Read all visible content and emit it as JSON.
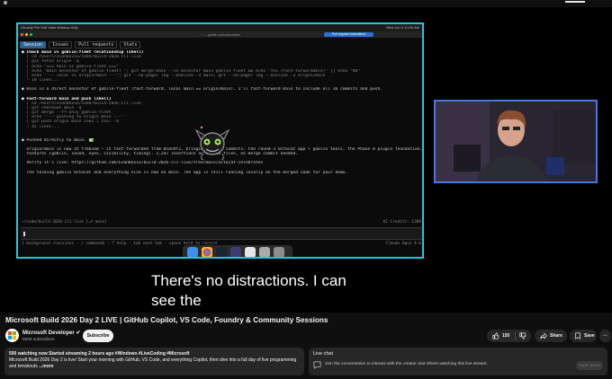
{
  "terminal": {
    "tabs": [
      "Session",
      "Issues",
      "Pull requests",
      "Stats"
    ],
    "lines": [
      {
        "text": "● Check main vs goblin-fleet relationship (shell)",
        "cls": "b"
      },
      {
        "text": "  │ cd /Users/evanbovie/code/build-2026-cli-live",
        "cls": "dim"
      },
      {
        "text": "  │ git fetch origin -q",
        "cls": "dim"
      },
      {
        "text": "  │ echo \"=== main vs goblin-fleet ===\"",
        "cls": "dim"
      },
      {
        "text": "  │ echo \"main ancestor of goblin-fleet? \"; git merge-base --is-ancestor main goblin-fleet && echo \"YES (fast-forwardable)\" || echo \"NO\"",
        "cls": "dim"
      },
      {
        "text": "  │ echo \"--- local vs origin/main ---\"; git --no-pager log --oneline -3 main; git --no-pager log --oneline -3 origin/main",
        "cls": "dim"
      },
      {
        "text": "  └ 10 lines...",
        "cls": "dim"
      },
      {
        "text": "",
        "cls": "sp"
      },
      {
        "text": "● main is a direct ancestor of goblin-fleet (fast-forward, local main == origin/main). I'll fast-forward main to include all 16 commits and push.",
        "cls": ""
      },
      {
        "text": "",
        "cls": "sp"
      },
      {
        "text": "● Fast-forward main and push (shell)",
        "cls": "b"
      },
      {
        "text": "  │ cd /Users/evanbovie/code/build-2026-cli-live",
        "cls": "dim"
      },
      {
        "text": "  │ git checkout main -q",
        "cls": "dim"
      },
      {
        "text": "  │ git merge --ff-only goblin-fleet",
        "cls": "dim"
      },
      {
        "text": "  │ echo \"--- pushing to origin main ---\"",
        "cls": "dim"
      },
      {
        "text": "  │ git push origin main 2>&1 | tail -8",
        "cls": "dim"
      },
      {
        "text": "  └ 45 lines...",
        "cls": "dim"
      },
      {
        "text": "",
        "cls": "sp"
      },
      {
        "text": "",
        "cls": "sp"
      },
      {
        "text": "● Pushed directly to main. ✅",
        "cls": ""
      },
      {
        "text": "",
        "cls": "sp"
      },
      {
        "text": "  origin/main is now at f7bb1e0 — it fast-forwarded from 85a59f2, bringing all 16 commits: the round-3 Octocat app + goblin tools, the Phase 0 plugin foundation, and all 5 fleet",
        "cls": ""
      },
      {
        "text": "  features (goblin, sound, eyes, visibility, timing). 2,247 insertions across 18 files, no merge commit needed.",
        "cls": ""
      },
      {
        "text": "",
        "cls": "sp"
      },
      {
        "text": "  Verify it's live: https://github.com/EvanBovie/build-2026-cli-live/tree/main/octocat-celebrates",
        "cls": ""
      },
      {
        "text": "",
        "cls": "sp"
      },
      {
        "text": "  The talking goblin Octocat and everything else is now on main. The app is still running locally on the merged code for your demo.",
        "cls": ""
      }
    ],
    "path": "~/code/build-2026-cli-live [⎇ main]",
    "credits": "AI Credits: 1309",
    "hints": "1 background /sessions · / commands · ? help · tab next tab · space hold to record",
    "model": "Claude Opus 4.6"
  },
  "menubar": {
    "left": "Ghostty   File   Edit   View   Window   Help",
    "right": "Wed Jun 3  10:00 AM"
  },
  "window_title": "~ — goblin-octocat-client",
  "window_badge": "Pull request instructions",
  "caption": "There's no distractions. I can see the",
  "video": {
    "title": "Microsoft Build 2026 Day 2 LIVE | GitHub Copilot, VS Code, Foundry & Community Sessions"
  },
  "channel": {
    "name": "Microsoft Developer",
    "subscribers": "883K subscribers",
    "subscribe_label": "Subscribe"
  },
  "actions": {
    "likes": "155",
    "share": "Share",
    "save": "Save"
  },
  "description": {
    "meta": "500 watching now  Started streaming 2 hours ago  #Windows #LiveCoding #Microsoft",
    "text": "Microsoft Build 2026 Day 2 is live! Start your morning with GitHub, VS Code, and everything Copilot, then dive into a full day of live programming and breakouts",
    "more": "...more"
  },
  "chat": {
    "header": "Live chat",
    "text": "Join the conversation to interact with the creator and others watching this live stream.",
    "button": "Open panel"
  },
  "colors": {
    "accent": "#27c6d6",
    "webcam_border": "#4a78d8",
    "link": "#6fb7ff"
  }
}
